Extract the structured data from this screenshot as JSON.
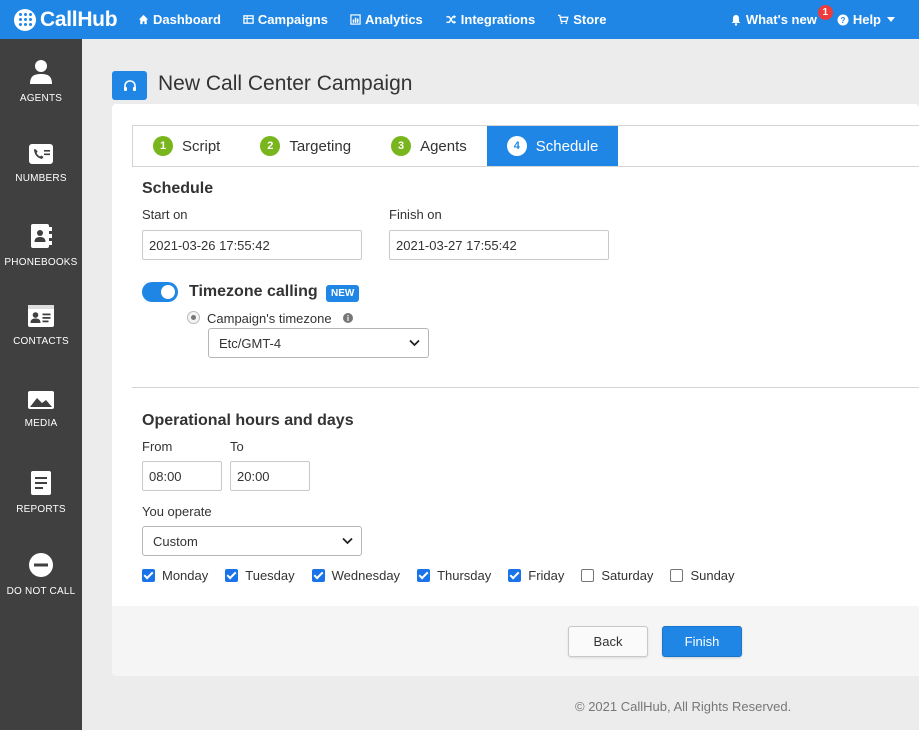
{
  "app": {
    "logo_text": "CallHub",
    "nav": [
      {
        "label": "Dashboard",
        "icon": "dashboard-icon"
      },
      {
        "label": "Campaigns",
        "icon": "campaigns-icon"
      },
      {
        "label": "Analytics",
        "icon": "analytics-icon"
      },
      {
        "label": "Integrations",
        "icon": "integrations-icon"
      },
      {
        "label": "Store",
        "icon": "cart-icon"
      }
    ],
    "whats_new": {
      "label": "What's new",
      "count": "1"
    },
    "help": {
      "label": "Help"
    }
  },
  "sidebar": {
    "items": [
      {
        "label": "AGENTS",
        "icon": "agent-icon"
      },
      {
        "label": "NUMBERS",
        "icon": "phone-card-icon"
      },
      {
        "label": "PHONEBOOKS",
        "icon": "phonebook-icon"
      },
      {
        "label": "CONTACTS",
        "icon": "contact-card-icon"
      },
      {
        "label": "MEDIA",
        "icon": "image-icon"
      },
      {
        "label": "REPORTS",
        "icon": "report-icon"
      },
      {
        "label": "DO NOT CALL",
        "icon": "no-entry-icon"
      }
    ]
  },
  "page": {
    "title": "New Call Center Campaign",
    "header_icon": "headset-icon"
  },
  "wizard": {
    "steps": [
      {
        "num": "1",
        "label": "Script",
        "active": false
      },
      {
        "num": "2",
        "label": "Targeting",
        "active": false
      },
      {
        "num": "3",
        "label": "Agents",
        "active": false
      },
      {
        "num": "4",
        "label": "Schedule",
        "active": true
      }
    ]
  },
  "schedule": {
    "heading": "Schedule",
    "start_label": "Start on",
    "start_value": "2021-03-26 17:55:42",
    "finish_label": "Finish on",
    "finish_value": "2021-03-27 17:55:42",
    "timezone_calling": {
      "label": "Timezone calling",
      "badge": "NEW",
      "enabled": true,
      "radio_label": "Campaign's timezone",
      "selected_timezone": "Etc/GMT-4"
    }
  },
  "operational": {
    "heading": "Operational hours and days",
    "from_label": "From",
    "from_value": "08:00",
    "to_label": "To",
    "to_value": "20:00",
    "operate_label": "You operate",
    "operate_value": "Custom",
    "days": [
      {
        "label": "Monday",
        "checked": true
      },
      {
        "label": "Tuesday",
        "checked": true
      },
      {
        "label": "Wednesday",
        "checked": true
      },
      {
        "label": "Thursday",
        "checked": true
      },
      {
        "label": "Friday",
        "checked": true
      },
      {
        "label": "Saturday",
        "checked": false
      },
      {
        "label": "Sunday",
        "checked": false
      }
    ]
  },
  "actions": {
    "back_label": "Back",
    "finish_label": "Finish"
  },
  "footer": {
    "copyright": "© 2021 CallHub, All Rights Reserved."
  },
  "colors": {
    "brand_blue": "#1f86e6",
    "sidebar_bg": "#404040",
    "step_green": "#79b51c",
    "badge_red": "#ee3b3b"
  }
}
